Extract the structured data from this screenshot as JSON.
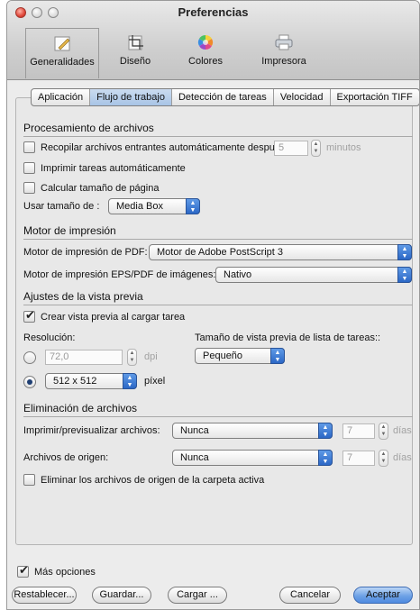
{
  "window": {
    "title": "Preferencias"
  },
  "toolbar": [
    {
      "label": "Generalidades",
      "icon": "pencil-document-icon"
    },
    {
      "label": "Diseño",
      "icon": "layout-crop-icon"
    },
    {
      "label": "Colores",
      "icon": "color-wheel-icon"
    },
    {
      "label": "Impresora",
      "icon": "printer-icon"
    }
  ],
  "tabs": [
    "Aplicación",
    "Flujo de trabajo",
    "Detección de tareas",
    "Velocidad",
    "Exportación TIFF"
  ],
  "sections": {
    "processing": "Procesamiento de archivos",
    "engine": "Motor de impresión",
    "preview": "Ajustes de la vista previa",
    "deletion": "Eliminación de archivos"
  },
  "processing": {
    "recompile_label": "Recopilar archivos entrantes automáticamente después",
    "recompile_value": "5",
    "recompile_unit": "minutos",
    "print_auto_label": "Imprimir tareas automáticamente",
    "calc_page_size_label": "Calcular tamaño de página",
    "use_size_label": "Usar tamaño de :",
    "use_size_value": "Media Box"
  },
  "engine": {
    "pdf_label": "Motor de impresión de PDF:",
    "pdf_value": "Motor de Adobe PostScript 3",
    "eps_label": "Motor de impresión EPS/PDF de imágenes:",
    "eps_value": "Nativo"
  },
  "preview": {
    "create_label": "Crear vista previa al cargar tarea",
    "resolution_label": "Resolución:",
    "dpi_value": "72,0",
    "dpi_unit": "dpi",
    "pixel_value": "512 x 512",
    "pixel_unit": "píxel",
    "list_size_label": "Tamaño de vista previa de lista de tareas::",
    "list_size_value": "Pequeño"
  },
  "deletion": {
    "print_label": "Imprimir/previsualizar archivos:",
    "print_value": "Nunca",
    "print_days": "7",
    "source_label": "Archivos de origen:",
    "source_value": "Nunca",
    "source_days": "7",
    "days_unit": "días",
    "delete_active_label": "Eliminar los archivos de origen de la carpeta activa"
  },
  "footer": {
    "more_options": "Más opciones",
    "reset": "Restablecer...",
    "save": "Guardar...",
    "load": "Cargar ...",
    "cancel": "Cancelar",
    "accept": "Aceptar"
  }
}
